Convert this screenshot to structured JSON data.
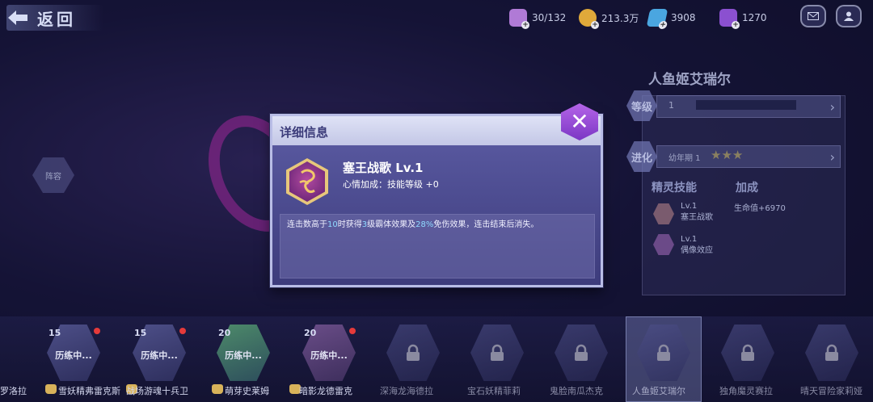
{
  "header": {
    "back_label": "返回",
    "resources": [
      {
        "name": "stamina",
        "icon": "stamina-card-icon",
        "value": "30/132",
        "color": "#b07ad6"
      },
      {
        "name": "gold",
        "icon": "gold-coin-icon",
        "value": "213.3万",
        "color": "#e0a93a"
      },
      {
        "name": "crystal",
        "icon": "crystal-icon",
        "value": "3908",
        "color": "#4aa6e0"
      },
      {
        "name": "gem",
        "icon": "purple-gem-icon",
        "value": "1270",
        "color": "#8b50d0"
      }
    ]
  },
  "side_button": "阵容",
  "character": {
    "name": "人鱼姬艾瑞尔",
    "level_label": "等级",
    "level_value": "1",
    "evolve_label": "进化",
    "evolve_stage": "幼年期 1",
    "stars": 3,
    "skills_label": "精灵技能",
    "bonus_label": "加成",
    "skills": [
      {
        "level": "Lv.1",
        "name": "塞王战歌",
        "icon": "song-skill-icon"
      },
      {
        "level": "Lv.1",
        "name": "偶像效应",
        "icon": "idol-skill-icon"
      }
    ],
    "bonus_value": "生命值+6970"
  },
  "modal": {
    "title": "详细信息",
    "skill_name": "塞王战歌 Lv.1",
    "mood_bonus": "心情加成：技能等级 +0",
    "desc_parts": [
      "连击数高于",
      "10",
      "时获得",
      "3",
      "级霸体效果及",
      "28%",
      "免伤效果，连击结束后消失。"
    ],
    "close_icon": "close-icon",
    "accent": "#8fd9ff"
  },
  "roster": [
    {
      "level": "15",
      "status": "历练中...",
      "name": "雪妖精弗雷克斯",
      "locked": false,
      "dot": true
    },
    {
      "level": "15",
      "status": "历练中...",
      "name": "战场游魂十兵卫",
      "locked": false,
      "dot": true
    },
    {
      "level": "20",
      "status": "历练中...",
      "name": "萌芽史莱姆",
      "locked": false,
      "dot": false
    },
    {
      "level": "20",
      "status": "历练中...",
      "name": "暗影龙德雷克",
      "locked": false,
      "dot": true
    },
    {
      "level": "",
      "status": "",
      "name": "深海龙海德拉",
      "locked": true,
      "dot": false
    },
    {
      "level": "",
      "status": "",
      "name": "宝石妖精菲莉",
      "locked": true,
      "dot": false
    },
    {
      "level": "",
      "status": "",
      "name": "鬼脸南瓜杰克",
      "locked": true,
      "dot": false
    },
    {
      "level": "",
      "status": "",
      "name": "人鱼姬艾瑞尔",
      "locked": true,
      "dot": false
    },
    {
      "level": "",
      "status": "",
      "name": "独角魔灵赛拉",
      "locked": true,
      "dot": false
    },
    {
      "level": "",
      "status": "",
      "name": "晴天冒险家莉娅",
      "locked": true,
      "dot": false
    }
  ],
  "roster_left_fragment": "罗洛拉"
}
